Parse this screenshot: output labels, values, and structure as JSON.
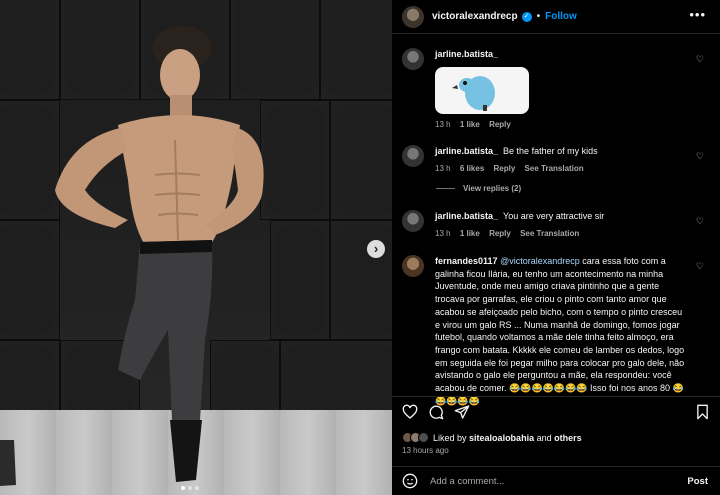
{
  "post": {
    "username": "victoralexandrecp",
    "separator": "•",
    "follow_label": "Follow",
    "more_label": "•••"
  },
  "comments": [
    {
      "user": "jarline.batista_",
      "text": "",
      "sticker": "blue-parrot-sticker",
      "time": "13 h",
      "likes": "1 like",
      "reply": "Reply",
      "translation": ""
    },
    {
      "user": "jarline.batista_",
      "text": "Be the father of my kids",
      "time": "13 h",
      "likes": "6 likes",
      "reply": "Reply",
      "translation": "See Translation"
    },
    {
      "user": "jarline.batista_",
      "text": "You are very attractive sir",
      "time": "13 h",
      "likes": "1 like",
      "reply": "Reply",
      "translation": "See Translation"
    },
    {
      "user": "fernandes0117",
      "mention": "@victoralexandrecp",
      "text": "cara essa foto com a galinha ficou Ilária, eu tenho um acontecimento na minha Juventude, onde meu amigo criava pintinho que a gente trocava por garrafas, ele criou o pinto com tanto amor que acabou se afeiçoado pelo bicho, com o tempo o pinto cresceu e virou um galo RS ... Numa manhã de domingo, fomos jogar futebol, quando voltamos a mãe dele tinha feito almoço, era frango com batata. Kkkkk ele comeu de lamber os dedos, logo em seguida ele foi pegar milho para colocar pro galo dele, não avistando o galo ele perguntou a mãe, ela respondeu: você acabou de comer. 😂😂😂😂😂😂😂 Isso foi nos anos 80 😂😂😂😂😂"
    }
  ],
  "view_replies": "View replies (2)",
  "liked_by": {
    "prefix": "Liked by",
    "user": "sitealoalobahia",
    "and": "and",
    "others": "others"
  },
  "post_time": "13 hours ago",
  "add_comment": {
    "placeholder": "Add a comment...",
    "post_label": "Post"
  },
  "icons": [
    "heart-icon",
    "comment-icon",
    "share-icon",
    "bookmark-icon",
    "emoji-icon",
    "chevron-right-icon",
    "verified-icon"
  ],
  "colors": {
    "accent": "#0095f6",
    "background": "#000000",
    "muted": "#a8a8a8"
  },
  "carousel": {
    "current": 1,
    "total": 3
  }
}
